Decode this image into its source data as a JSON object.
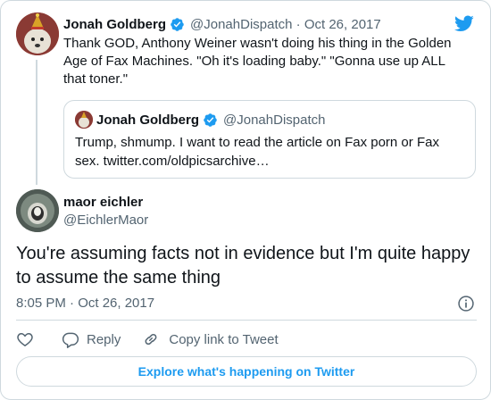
{
  "parent_tweet": {
    "author_name": "Jonah Goldberg",
    "author_handle": "@JonahDispatch",
    "separator": " · ",
    "date": "Oct 26, 2017",
    "text": "Thank GOD, Anthony Weiner wasn't doing his thing in the Golden Age of Fax Machines. \"Oh it's loading baby.\" \"Gonna use up ALL that toner.\"",
    "quoted_tweet": {
      "author_name": "Jonah Goldberg",
      "author_handle": "@JonahDispatch",
      "text": "Trump, shmump. I want to read the article on Fax porn or Fax sex. twitter.com/oldpicsarchive…"
    }
  },
  "main_tweet": {
    "author_name": "maor eichler",
    "author_handle": "@EichlerMaor",
    "text": "You're assuming facts not in evidence but I'm quite happy to assume the same thing",
    "timestamp": "8:05 PM · Oct 26, 2017"
  },
  "actions": {
    "reply_label": "Reply",
    "copy_link_label": "Copy link to Tweet"
  },
  "explore_label": "Explore what's happening on Twitter",
  "icons": [
    "twitter-logo",
    "verified-badge-icon",
    "info-icon",
    "heart-icon",
    "reply-icon",
    "link-icon"
  ],
  "colors": {
    "brand_blue": "#1d9bf0",
    "secondary_text": "#536471",
    "border": "#cfd9de"
  }
}
